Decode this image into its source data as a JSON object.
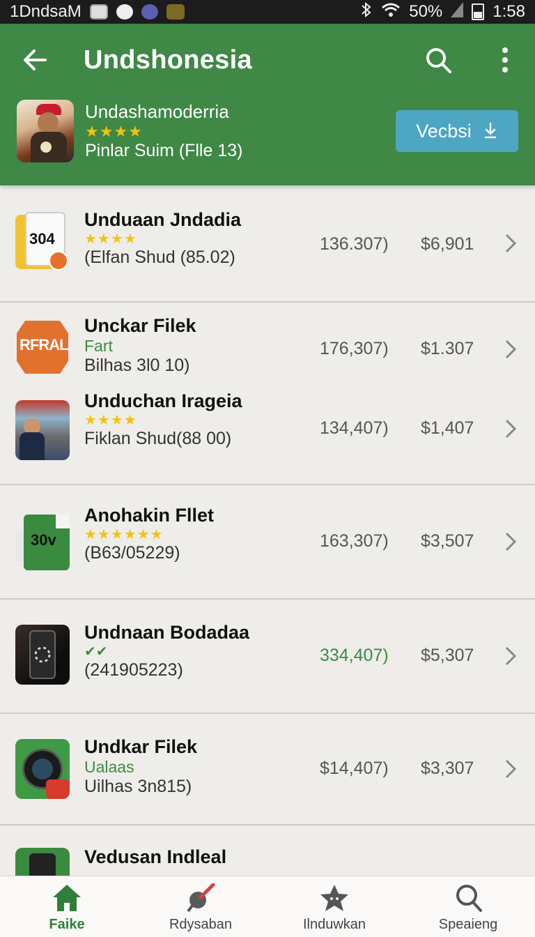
{
  "status": {
    "carrier": "1DndsaM",
    "battery": "50%",
    "time": "1:58"
  },
  "header": {
    "title": "Undshonesia",
    "featured": {
      "name": "Undashamoderria",
      "stars": "★★★★",
      "subtitle": "Pinlar Suim (Flle 13)",
      "button_label": "Vecbsi"
    }
  },
  "list": [
    {
      "name": "Unduaan Jndadia",
      "stars": "★★★★",
      "sub": "(Elfan Shud (85.02)",
      "num1": "136.307)",
      "num2": "$6,901",
      "thumb": "phone-file-icon",
      "thumb_text": "304"
    },
    {
      "name": "Unckar Filek",
      "green": "Fart",
      "sub": "Bilhas 3l0 10)",
      "num1": "176,307)",
      "num2": "$1.307",
      "thumb": "badge-icon",
      "thumb_text": "RFRAL"
    },
    {
      "name": "Unduchan Iragеia",
      "stars": "★★★★",
      "sub": "Fiklan Shud(88 00)",
      "num1": "134,407)",
      "num2": "$1,407",
      "thumb": "photo-thumbnail"
    },
    {
      "name": "Anohakin Fllet",
      "stars": "★★★★★★",
      "sub": "(B63/05229)",
      "num1": "163,307)",
      "num2": "$3,507",
      "thumb": "green-file-icon",
      "thumb_text": "30v"
    },
    {
      "name": "Undnaan Bodadaa",
      "stars": "✔✔",
      "sub": "(241905223)",
      "num1": "334,407)",
      "num2": "$5,307",
      "thumb": "phone-loading-icon"
    },
    {
      "name": "Undkar Filek",
      "green": "Ualaas",
      "sub": "Uilhas 3n815)",
      "num1": "$14,407)",
      "num2": "$3,307",
      "thumb": "camera-icon"
    },
    {
      "name": "Vedusan Indleal",
      "thumb": "phone-icon"
    }
  ],
  "bottom_nav": [
    {
      "label": "Faike",
      "icon": "home-icon"
    },
    {
      "label": "Rdysaban",
      "icon": "pin-icon"
    },
    {
      "label": "Ilnduwkan",
      "icon": "star-icon"
    },
    {
      "label": "Speaieng",
      "icon": "search-icon"
    }
  ],
  "colors": {
    "header_green": "#3f8846",
    "accent_blue": "#4da6c2",
    "star_yellow": "#f4c20d",
    "positive_green": "#3a8c3f"
  }
}
